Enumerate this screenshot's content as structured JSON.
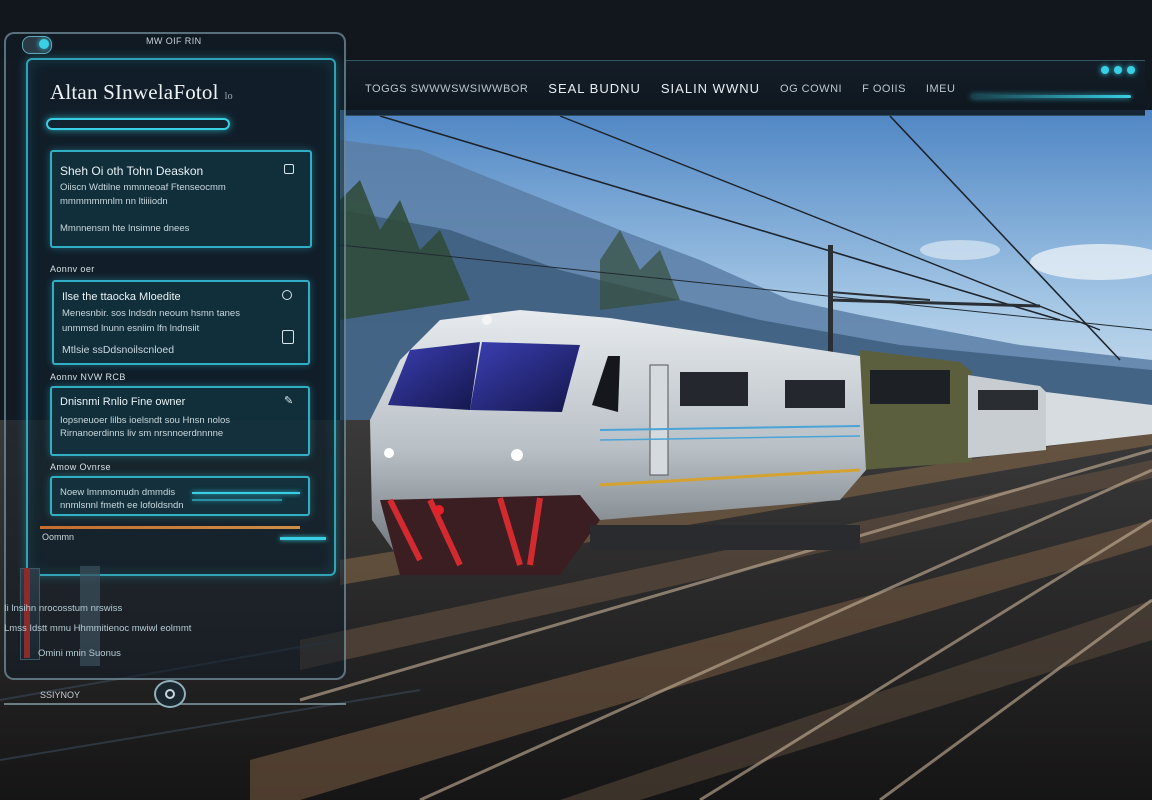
{
  "app": {
    "subtitle": "MW OIF RIN",
    "title": "Altan SInwelaFotol",
    "title_suffix": "lo"
  },
  "topbar": {
    "items": [
      {
        "label": "TOGGS SWWWSWSIWWBOR"
      },
      {
        "label": "SEAL BUDNU"
      },
      {
        "label": "SIALIN WWNU"
      },
      {
        "label": "OG COWNI"
      },
      {
        "label": "F OOIIS"
      },
      {
        "label": "IMEU"
      }
    ]
  },
  "cards": [
    {
      "title": "Sheh Oi oth Tohn Deaskon",
      "lines": [
        "Oiiscn Wdtilne mmnneoaf Ftenseocmm",
        "mmmmmmnlm nn ltiiiiodn",
        "Mmnnensm hte lnsimne dnees"
      ]
    },
    {
      "title": "Ilse the ttaocka Mloedite",
      "lines": [
        "Menesnbir. sos lndsdn neoum hsmn tanes",
        "unmmsd lnunn esniim lfn lndnsiit",
        "Mtlsie ssDdsnoilscnloed"
      ]
    },
    {
      "title": "Dnisnmi Rnlio Fine owner",
      "lines": [
        "Iopsneuoer lilbs ioelsndt sou Hnsn nolos",
        "Rirnanoerdinns liv sm nrsnnoerdnnnne",
        ""
      ]
    },
    {
      "title": "",
      "lines": [
        "Noew lmnmomudn dmmdis",
        "nnmlsnnl fmeth ee lofoldsndn"
      ]
    }
  ],
  "sections": {
    "s1": "Aonnv oer",
    "s2": "Aonnv NVW RCB",
    "s3": "Amow Ovnrse"
  },
  "footer": {
    "panel_label": "Oommn",
    "lower_1": "Ii lnsihn nrocosstum nrswiss",
    "lower_2": "Lmss Idstt mmu Hhmmitienoc mwiwl eolmmt",
    "lower_3": "Omini mnin Suonus",
    "bottom_label": "SSIYNOY"
  },
  "colors": {
    "accent": "#39d0e6",
    "panel_bg": "#12222e",
    "orange": "#d8762e"
  }
}
